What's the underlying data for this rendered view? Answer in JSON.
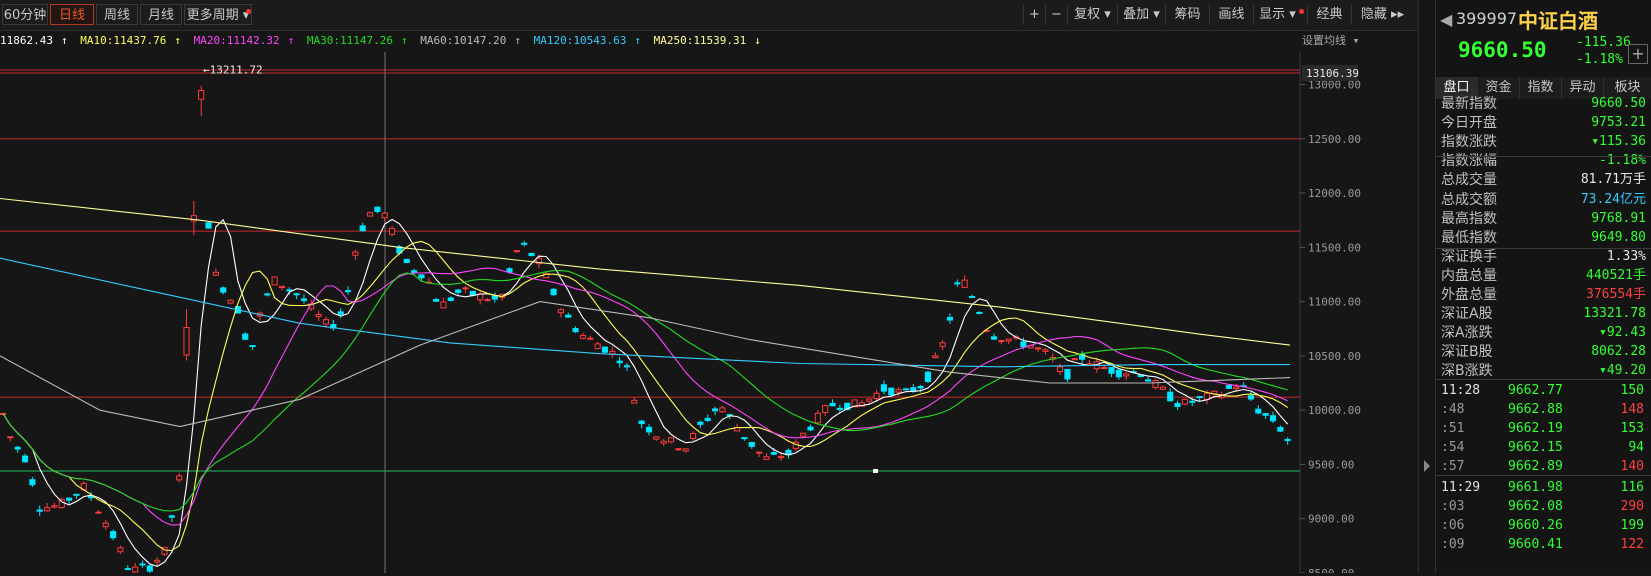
{
  "toolbar": {
    "tabs": [
      {
        "label": "60分钟",
        "active": false
      },
      {
        "label": "日线",
        "active": true
      },
      {
        "label": "周线",
        "active": false
      },
      {
        "label": "月线",
        "active": false
      },
      {
        "label": "更多周期 ▾",
        "active": false
      }
    ],
    "right_buttons": [
      "+",
      "−",
      "复权 ▾",
      "叠加 ▾",
      "筹码",
      "画线",
      "显示 ▾",
      "经典",
      "隐藏 ▸▸"
    ]
  },
  "ma_bar": {
    "ma5": "11862.43",
    "ma10": "MA10:11437.76",
    "ma20": "MA20:11142.32",
    "ma30": "MA30:11147.26",
    "ma60": "MA60:10147.20",
    "ma120": "MA120:10543.63",
    "ma250": "MA250:11539.31",
    "settings": "设置均线 ▾"
  },
  "chart_data": {
    "type": "candlestick",
    "yaxis": {
      "min": 8500,
      "max": 13106.39,
      "ticks": [
        13000,
        12500,
        12000,
        11500,
        11000,
        10500,
        10000,
        9500,
        9000,
        8500
      ]
    },
    "top_price_label": "13106.39",
    "high_marker": "←13211.72",
    "levels": [
      13106.39,
      12500,
      11650,
      10120,
      9440
    ],
    "candle_count": 176,
    "colors": {
      "up": "#ff3b3b",
      "down": "#00e5ff",
      "ma5": "#ffffff",
      "ma10": "#ffff55",
      "ma20": "#ff44ff",
      "ma30": "#22dd22",
      "ma60": "#bbbbbb",
      "ma120": "#33ccff",
      "ma250": "#ffff99"
    }
  },
  "panel": {
    "code": "399997",
    "name": "中证白酒",
    "price": "9660.50",
    "change": "-115.36",
    "change_pct": "-1.18%",
    "add_label": "+",
    "tabs": [
      "盘口",
      "资金",
      "指数",
      "异动",
      "板块"
    ],
    "stats": [
      {
        "k": "最新指数",
        "v": "9660.50",
        "c": "#33ff33"
      },
      {
        "k": "今日开盘",
        "v": "9753.21",
        "c": "#33ff33"
      },
      {
        "k": "指数涨跌",
        "v": "▾115.36",
        "c": "#33ff33"
      },
      {
        "k": "指数涨幅",
        "v": "-1.18%",
        "c": "#33ff33"
      },
      {
        "k": "总成交量",
        "v": "81.71万手",
        "c": "#e8e8e8"
      },
      {
        "k": "总成交额",
        "v": "73.24亿元",
        "c": "#33ccff"
      },
      {
        "k": "最高指数",
        "v": "9768.91",
        "c": "#33ff33"
      },
      {
        "k": "最低指数",
        "v": "9649.80",
        "c": "#33ff33"
      },
      {
        "k": "深证换手",
        "v": "1.33%",
        "c": "#e8e8e8"
      },
      {
        "k": "内盘总量",
        "v": "440521手",
        "c": "#33ff33"
      },
      {
        "k": "外盘总量",
        "v": "376554手",
        "c": "#ff4040"
      },
      {
        "k": "深证A股",
        "v": "13321.78",
        "c": "#33ff33"
      },
      {
        "k": "深A涨跌",
        "v": "▾92.43",
        "c": "#33ff33"
      },
      {
        "k": "深证B股",
        "v": "8062.28",
        "c": "#33ff33"
      },
      {
        "k": "深B涨跌",
        "v": "▾49.20",
        "c": "#33ff33"
      }
    ],
    "ticks": [
      {
        "t": "11:28",
        "p": "9662.77",
        "v": "150",
        "vc": "#33ff33"
      },
      {
        "t": ":48",
        "p": "9662.88",
        "v": "148",
        "vc": "#ff4040"
      },
      {
        "t": ":51",
        "p": "9662.19",
        "v": "153",
        "vc": "#33ff33"
      },
      {
        "t": ":54",
        "p": "9662.15",
        "v": "94",
        "vc": "#33ff33"
      },
      {
        "t": ":57",
        "p": "9662.89",
        "v": "140",
        "vc": "#ff4040"
      },
      {
        "t": "11:29",
        "p": "9661.98",
        "v": "116",
        "vc": "#33ff33"
      },
      {
        "t": ":03",
        "p": "9662.08",
        "v": "290",
        "vc": "#ff4040"
      },
      {
        "t": ":06",
        "p": "9660.26",
        "v": "199",
        "vc": "#33ff33"
      },
      {
        "t": ":09",
        "p": "9660.41",
        "v": "122",
        "vc": "#ff4040"
      }
    ]
  }
}
